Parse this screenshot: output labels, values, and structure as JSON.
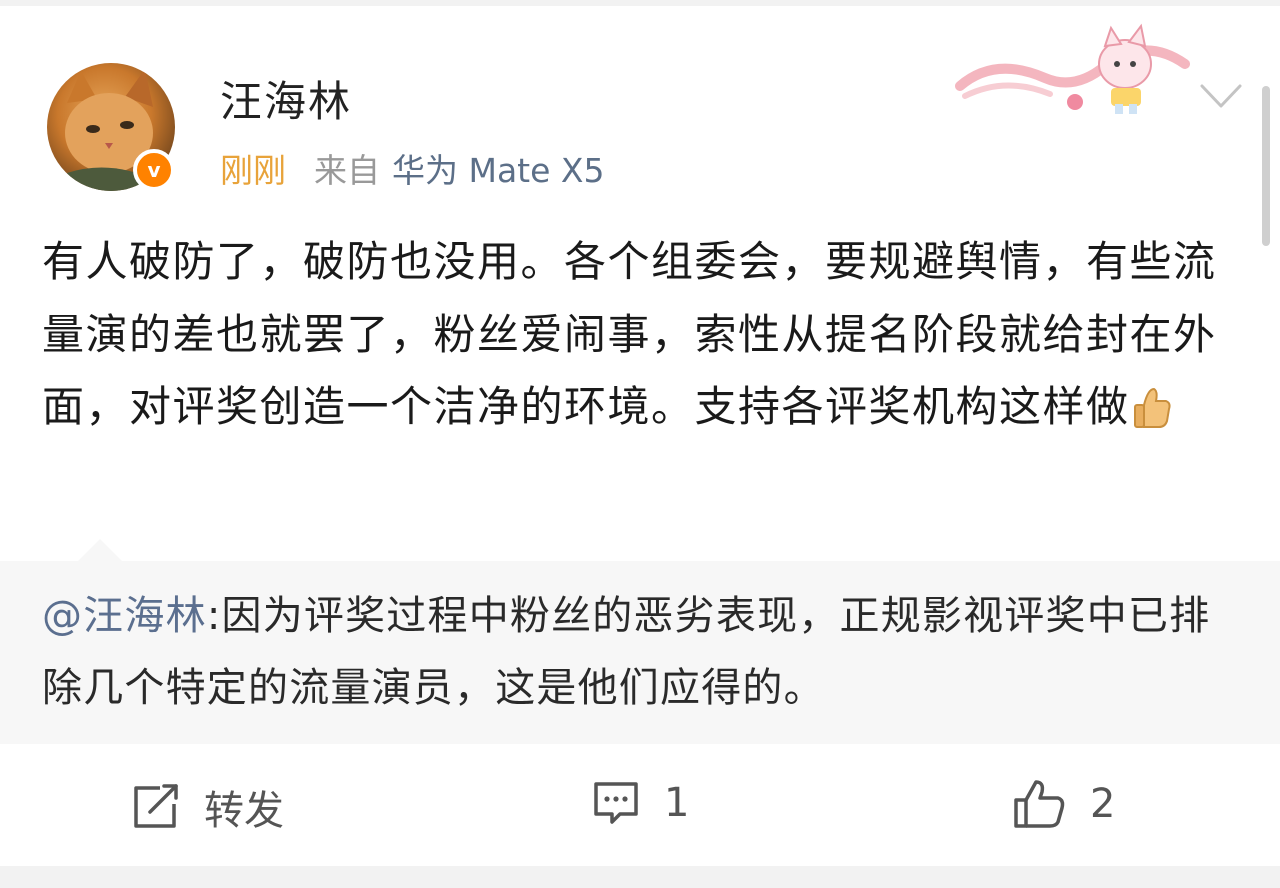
{
  "post": {
    "username": "汪海林",
    "time": "刚刚",
    "source_prefix": "来自",
    "device": "华为 Mate X5",
    "verified_badge": "v",
    "body": "有人破防了，破防也没用。各个组委会，要规避舆情，有些流量演的差也就罢了，粉丝爱闹事，索性从提名阶段就给封在外面，对评奖创造一个洁净的环境。支持各评奖机构这样做",
    "body_emoji": "thumbs-up"
  },
  "quote": {
    "mention": "@汪海林",
    "text": ":因为评奖过程中粉丝的恶劣表现，正规影视评奖中已排除几个特定的流量演员，这是他们应得的。"
  },
  "actions": {
    "repost_label": "转发",
    "comment_count": "1",
    "like_count": "2"
  },
  "icons": {
    "repost": "repost-icon",
    "comment": "comment-icon",
    "like": "like-icon",
    "dropdown": "chevron-down-icon"
  },
  "colors": {
    "time": "#e8a33a",
    "device": "#5c6f88",
    "mention": "#5b6f8f",
    "verified": "#ff8200"
  }
}
